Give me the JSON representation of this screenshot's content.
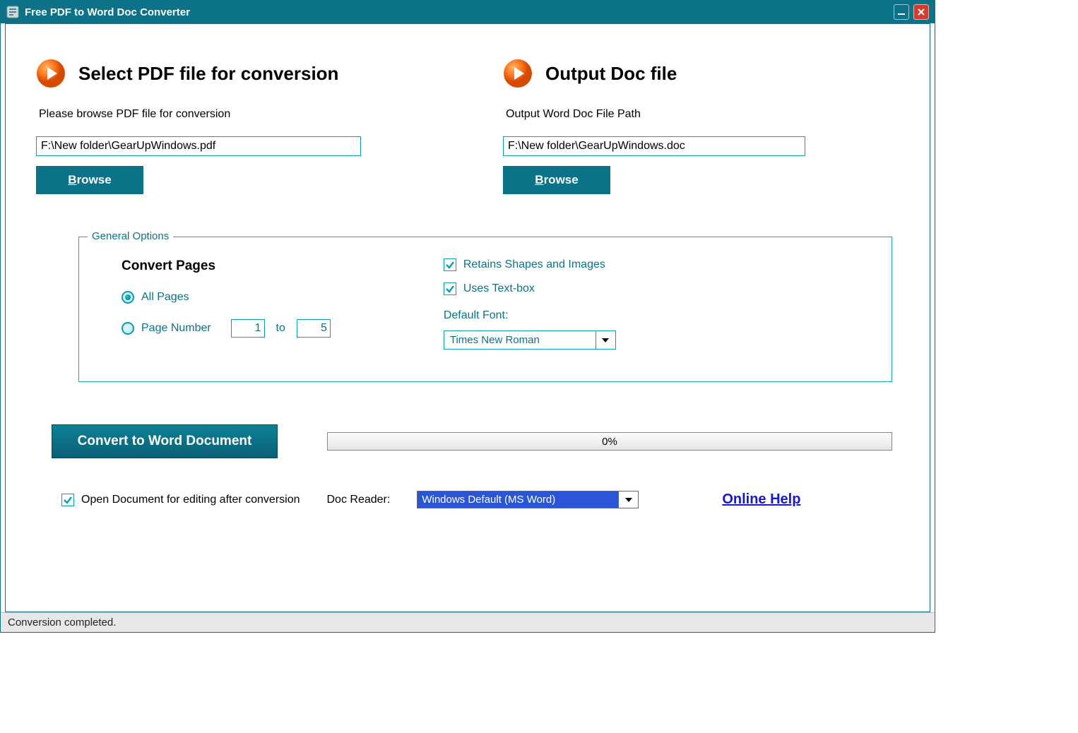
{
  "title": "Free PDF to Word Doc Converter",
  "input": {
    "heading": "Select PDF file for conversion",
    "label": "Please browse PDF file for conversion",
    "path": "F:\\New folder\\GearUpWindows.pdf",
    "browse": "Browse"
  },
  "output": {
    "heading": "Output Doc file",
    "label": "Output Word Doc File Path",
    "path": "F:\\New folder\\GearUpWindows.doc",
    "browse": "Browse"
  },
  "options": {
    "legend": "General Options",
    "convert_pages_title": "Convert Pages",
    "all_pages": "All Pages",
    "page_number": "Page Number",
    "page_from": "1",
    "to": "to",
    "page_to": "5",
    "retain_shapes": "Retains Shapes and Images",
    "uses_textbox": "Uses Text-box",
    "default_font_label": "Default Font:",
    "default_font": "Times New Roman"
  },
  "convert_button": "Convert to Word Document",
  "progress": "0%",
  "open_after": "Open Document for editing after conversion",
  "doc_reader_label": "Doc Reader:",
  "doc_reader": "Windows Default (MS Word)",
  "help": "Online Help",
  "status": "Conversion completed."
}
